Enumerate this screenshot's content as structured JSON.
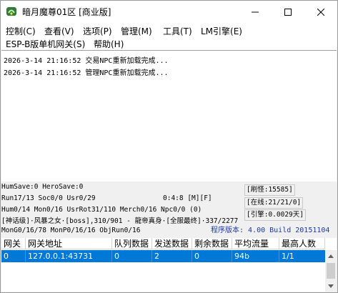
{
  "window": {
    "title": "暗月魔尊01区 [商业版]"
  },
  "menu": [
    "控制(C)",
    "查看(V)",
    "选项(P)",
    "管理(M)",
    "工具(T)",
    "LM引擎(E)",
    "ESP-B版单机网关(S)",
    "帮助(H)"
  ],
  "log": [
    "2026-3-14 21:16:52 交易NPC重新加载完成...",
    "2026-3-14 21:16:52 管理NPC重新加载完成..."
  ],
  "status": {
    "humsave": "HumSave:0 HeroSave:0",
    "run": "Run17/13 Soc0/0 Usr0/29",
    "ratio": "0:4:8 [M][F]",
    "hum": "Hum0/14 Mon0/16 UsrRot31/110 Merch0/16 Npc0/0 (0)",
    "boss_line": "[神话级]·风暴之女·[boss],310/901 - 龍帝真身·[全服最终]·337/2277",
    "mon": "MonG0/16/78 MonP0/16/16 ObjRun0/16",
    "monster_count": "[刷怪:15585]",
    "online": "[在线:21/21/0]",
    "engine": "[引擎:0.0029天]",
    "version": "程序版本: 4.00 Build 20151104"
  },
  "table": {
    "columns": [
      "网关",
      "网关地址",
      "队列数据",
      "发送数据",
      "剩余数据",
      "平均流量",
      "最高人数"
    ],
    "rows": [
      [
        "0",
        "127.0.0.1:43731",
        "0",
        "2",
        "0",
        "94b",
        "1/1"
      ]
    ]
  }
}
